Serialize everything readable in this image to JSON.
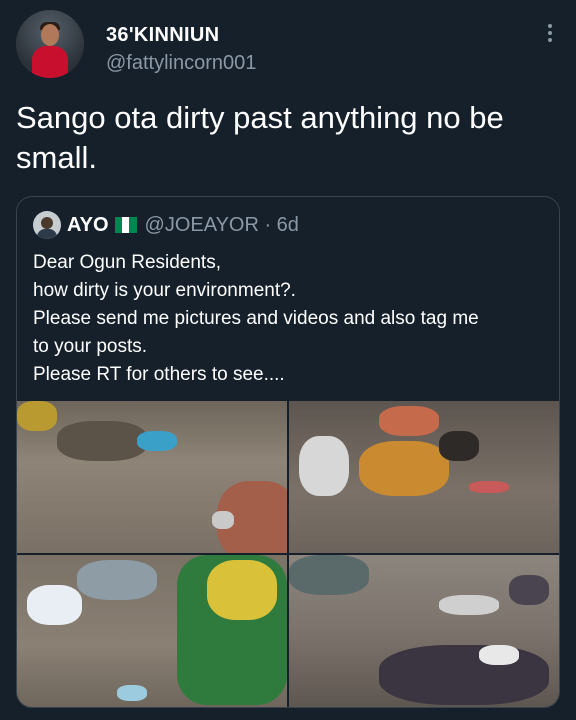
{
  "author": {
    "name": "36'KINNIUN",
    "handle": "@fattylincorn001"
  },
  "tweet": {
    "text": "Sango ota dirty past anything no be small."
  },
  "quoted": {
    "name": "AYO",
    "handle_time": "@JOEAYOR · 6d",
    "lines": [
      "Dear Ogun Residents,",
      "how dirty is your environment?.",
      "Please send me pictures and videos and also tag me",
      "to your posts.",
      "Please RT for others to see...."
    ],
    "flag_colors": [
      "#008751",
      "#ffffff",
      "#008751"
    ]
  },
  "icons": {
    "more": "more-vertical-icon"
  },
  "colors": {
    "background": "#15202b",
    "secondary_text": "#8b98a5",
    "border": "#38444d"
  }
}
